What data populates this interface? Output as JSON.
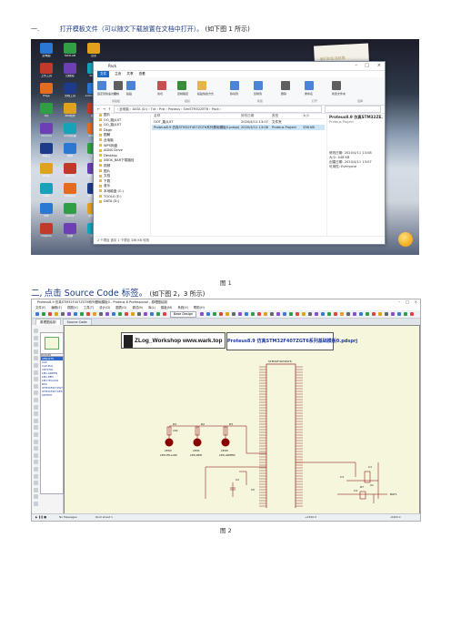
{
  "step1": {
    "number": "一.",
    "main": "打开模板文件（可以随文下载放置在文档中打开）。",
    "note": "(如下图 1 所示)"
  },
  "figure1": {
    "caption": "图 1",
    "desktop_icons": [
      "此电脑",
      "MATLAB",
      "迅雷",
      "上传工具",
      "回收站",
      "Skype",
      "Edge",
      "文档工具",
      "ArchiveWa...",
      "QQ",
      "360软件",
      "微信",
      "Chrome",
      "QQ浏览器",
      "Arduino",
      "网易云",
      "搜狗",
      "视频",
      "Edge",
      "Typora",
      "Pycharm",
      "IDEA",
      "VMware",
      "Notepad",
      "IDE",
      "Xshell",
      "文件助手",
      "FileZilla",
      "终端",
      "VNC",
      "Chrome",
      "Proteus",
      "网盘",
      "百度",
      "Word",
      "Python",
      "WPS",
      "Firefox",
      "KeyShot",
      "软件",
      "设置",
      "360"
    ],
    "explorer": {
      "title": "Pack",
      "tabs": [
        "文件",
        "主页",
        "共享",
        "查看"
      ],
      "ribbon_labels": [
        "固定到快速访问",
        "复制",
        "粘贴",
        "剪切",
        "复制路径",
        "粘贴快捷方式",
        "移动到",
        "复制到",
        "删除",
        "重命名",
        "新建文件夹",
        "新建项目",
        "轻松访问",
        "属性",
        "打开",
        "编辑",
        "历史记录",
        "全部选择",
        "全部取消",
        "反向选择"
      ],
      "ribbon_groups": [
        "剪贴板",
        "组织",
        "新建",
        "打开",
        "选择"
      ],
      "address": "› 此电脑 › DATA (D:) › Txt › Pcb › Proteus › SimSTM32ZET6 › Pack ›",
      "sidebar": [
        "图片",
        "OO_路从XT",
        "OO_路从XT",
        "Dkgh",
        "图解",
        "此电脑",
        "WPS网盘",
        "AGNS Drive",
        "Desktop",
        "XBOX_BAR下载路径",
        "视频",
        "图片",
        "文档",
        "下载",
        "音乐",
        "本地磁盘 (C:)",
        "TOOLS (E:)",
        "DATA (D:)"
      ],
      "columns": [
        "名称",
        "修改日期",
        "类型",
        "大小"
      ],
      "rows": [
        {
          "name": "OOT_路从XT",
          "date": "2020/4/11 13:07",
          "type": "文件夹",
          "size": ""
        },
        {
          "name": "Proteus8.9 仿真STM32F407ZGT6系列基础模板0.pdsprj",
          "date": "2020/4/11 13:08",
          "type": "Proteus Project",
          "size": "336 KB"
        }
      ],
      "preview": {
        "title": "Proteus8.9 仿真STM32ZE...",
        "subtitle": "Proteus Project",
        "props": [
          {
            "k": "修改日期:",
            "v": "2020/4/11 13:08"
          },
          {
            "k": "大小:",
            "v": "448 KB"
          },
          {
            "k": "创建日期:",
            "v": "2020/4/11 13:07"
          },
          {
            "k": "可用性:",
            "v": "Everyone"
          }
        ]
      },
      "status": "2 个项目   选中 1 个项目 336 KB   可用"
    },
    "desktop_note": "我们的生活就像"
  },
  "step2": {
    "number": "二,",
    "main": "点击 Source Code 标签。",
    "note": "(如下图 2，3 所示)"
  },
  "figure2": {
    "caption": "图 2",
    "window_title": "Proteus8.9 仿真STM32F407ZGT6系列基础模板0 - Proteus 8 Professional - 原理图绘制",
    "menu": [
      "文件(F)",
      "编辑(E)",
      "视图(V)",
      "工具(T)",
      "设计(D)",
      "图表(G)",
      "调试(B)",
      "库(L)",
      "模板(M)",
      "系统(Y)",
      "帮助(H)"
    ],
    "tabs": [
      "原理图绘制",
      "Source Code"
    ],
    "toolbar_dropdown": "Base Design",
    "device_list_header": "DEVICES",
    "devices": [
      "AMIO2TS",
      "CAP",
      "CAP-POL",
      "CRYSTAL",
      "LED-GREEN",
      "LED-RED",
      "LED-YELLOW",
      "RES",
      "STM32F407ZGT6",
      "STM32F407VET6",
      "SWITCH"
    ],
    "banner_left": "ZLog_Workshop  www.wark.top",
    "banner_right": "Proteus8.9 仿真STM32F407ZGT6系列基础模板0.pdsprj",
    "components": [
      "R4",
      "R2",
      "R3",
      "LED2",
      "LED1",
      "LED0",
      "C1",
      "C2",
      "C3",
      "C4",
      "C5",
      "X1",
      "R7",
      "BAT1",
      "LED-YELLOW",
      "LED-RED",
      "LED-GREEN",
      "10k",
      "STM32F407ZGT6"
    ],
    "status": {
      "messages": "No Messages",
      "sheet": "Root sheet 1",
      "x": "+1300.0",
      "y": "-6400.0"
    }
  },
  "colors": {
    "heading_blue": "#1a3a8a",
    "selection": "#cce4f7",
    "sheet_bg": "#f6f6dc",
    "wire": "#800000"
  }
}
